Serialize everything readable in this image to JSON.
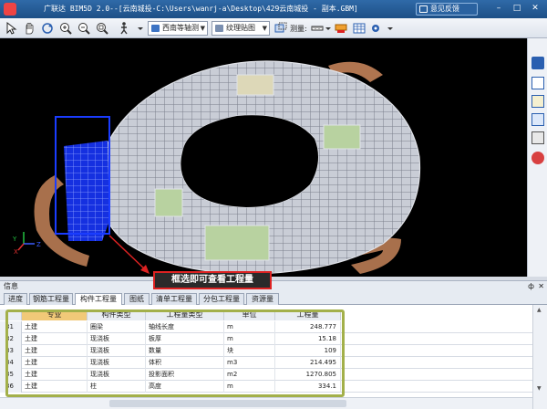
{
  "window": {
    "title": "广联达 BIM5D 2.0--[云南城投-C:\\Users\\wanrj-a\\Desktop\\429云南城投 - 副本.GBM]",
    "report_button": "意见反馈",
    "controls": [
      "–",
      "□",
      "✕"
    ]
  },
  "toolbar": {
    "icons": [
      "select-icon",
      "pan-icon",
      "rotate-icon",
      "zoom-in-icon",
      "zoom-out-icon",
      "zoom-window-icon",
      "zoom-all-icon",
      "walk-icon",
      "dropdown-icon"
    ],
    "view_combo": "西南等轴测",
    "render_combo": "纹理贴图",
    "measure_label": "测量:",
    "right_icons": [
      "box-select-icon",
      "grid-icon",
      "measure-ruler-icon",
      "highlight-icon",
      "settings-icon"
    ]
  },
  "viewport": {
    "axis_labels": {
      "x": "X",
      "y": "Y",
      "z": "Z"
    }
  },
  "right_toolbar": {
    "icons": [
      "properties-icon",
      "chart-icon",
      "edit-icon",
      "layer-icon",
      "camera-icon",
      "export-icon"
    ]
  },
  "callout": {
    "text": "框选即可查看工程量"
  },
  "info_panel": {
    "title": "信息",
    "pin": "ф",
    "close": "✕",
    "tabs": [
      "进度",
      "钢筋工程量",
      "构件工程量",
      "图纸",
      "清单工程量",
      "分包工程量",
      "资源量"
    ],
    "active_tab": 2,
    "columns": [
      "专业",
      "构件类型",
      "工程量类型",
      "单位",
      "工程量"
    ],
    "rows": [
      {
        "n": "31",
        "major": "土建",
        "type": "圈梁",
        "qty_type": "轴线长度",
        "unit": "m",
        "value": "248.777"
      },
      {
        "n": "32",
        "major": "土建",
        "type": "现浇板",
        "qty_type": "板厚",
        "unit": "m",
        "value": "15.18"
      },
      {
        "n": "33",
        "major": "土建",
        "type": "现浇板",
        "qty_type": "数量",
        "unit": "块",
        "value": "109"
      },
      {
        "n": "34",
        "major": "土建",
        "type": "现浇板",
        "qty_type": "体积",
        "unit": "m3",
        "value": "214.495"
      },
      {
        "n": "35",
        "major": "土建",
        "type": "现浇板",
        "qty_type": "投影面积",
        "unit": "m2",
        "value": "1270.805"
      },
      {
        "n": "36",
        "major": "土建",
        "type": "柱",
        "qty_type": "高度",
        "unit": "m",
        "value": "334.1"
      }
    ]
  },
  "colors": {
    "titlebar": "#1d4f86",
    "viewport_bg": "#000000",
    "selection_box": "#1a3cff",
    "callout_border": "#dd2222",
    "highlight_box": "#a3b04a",
    "sorted_header": "#f1c978"
  }
}
